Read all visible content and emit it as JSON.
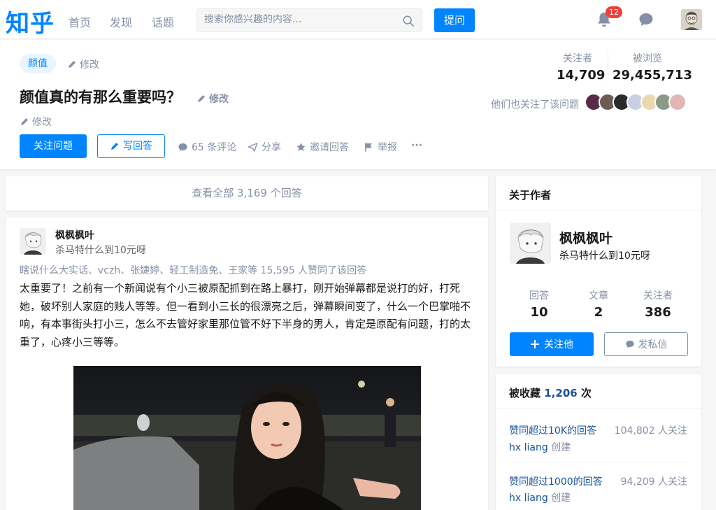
{
  "topbar": {
    "logo": "知乎",
    "nav": [
      "首页",
      "发现",
      "话题"
    ],
    "search_placeholder": "搜索你感兴趣的内容...",
    "ask_label": "提问",
    "notification_count": "12"
  },
  "question": {
    "topic": "颜值",
    "edit_label": "修改",
    "title": "颜值真的有那么重要吗？",
    "follow_button": "关注问题",
    "write_answer_button": "写回答",
    "actions": {
      "comments": "65 条评论",
      "share": "分享",
      "invite": "邀请回答",
      "report": "举报",
      "more": "···"
    },
    "stats": {
      "followers_label": "关注者",
      "followers": "14,709",
      "views_label": "被浏览",
      "views": "29,455,713"
    },
    "also_followed": "他们也关注了该问题"
  },
  "main": {
    "view_all": "查看全部 3,169 个回答",
    "answer": {
      "author_name": "枫枫枫叶",
      "author_headline": "杀马特什么到10元呀",
      "voters": "瞎说什么大实话、vczh、张婕婷、轻工制造免、王家等 15,595 人赞同了该回答",
      "body": "太重要了！之前有一个新闻说有个小三被原配抓到在路上暴打，刚开始弹幕都是说打的好，打死她，破坏别人家庭的贱人等等。但一看到小三长的很漂亮之后，弹幕瞬间变了，什么一个巴掌啪不响，有本事街头打小三，怎么不去管好家里那位管不好下半身的男人，肯定是原配有问题，打的太重了，心疼小三等等。"
    }
  },
  "sidebar": {
    "about_author": {
      "title": "关于作者",
      "name": "枫枫枫叶",
      "headline": "杀马特什么到10元呀",
      "stats": [
        {
          "label": "回答",
          "value": "10"
        },
        {
          "label": "文章",
          "value": "2"
        },
        {
          "label": "关注者",
          "value": "386"
        }
      ],
      "follow_button": "关注他",
      "message_button": "发私信"
    },
    "collections": {
      "title_prefix": "被收藏",
      "count": "1,206",
      "title_suffix": "次",
      "items": [
        {
          "name": "赞同超过10K的回答",
          "followers": "104,802 人关注",
          "creator": "hx liang",
          "created": "创建"
        },
        {
          "name": "赞同超过1000的回答",
          "followers": "94,209 人关注",
          "creator": "hx liang",
          "created": "创建"
        }
      ]
    }
  },
  "colors": {
    "brand": "#0084ff",
    "link": "#175199",
    "muted": "#8590a6",
    "badge": "#f1403c"
  }
}
